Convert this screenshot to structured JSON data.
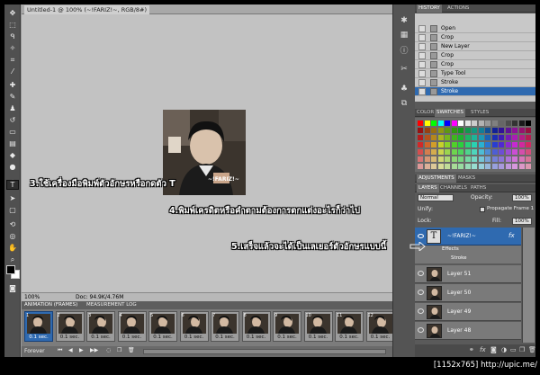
{
  "document": {
    "tab_title": "Untitled-1 @ 100% (~!FARIZ!~, RGB/8#)",
    "zoom": "100%",
    "doc_size": "Doc: 94.9K/4.76M",
    "canvas_watermark": "~!FARIZ!~"
  },
  "history_panel": {
    "tabs": [
      "HISTORY",
      "ACTIONS"
    ],
    "steps": [
      "Open",
      "Crop",
      "New Layer",
      "Crop",
      "Crop",
      "Type Tool",
      "Stroke",
      "Stroke"
    ],
    "selected_index": 7
  },
  "swatches_panel": {
    "tabs": [
      "COLOR",
      "SWATCHES",
      "STYLES"
    ]
  },
  "adjustments_panel": {
    "tabs": [
      "ADJUSTMENTS",
      "MASKS"
    ]
  },
  "layers_panel": {
    "tabs": [
      "LAYERS",
      "CHANNELS",
      "PATHS"
    ],
    "blend_mode": "Normal",
    "opacity_label": "Opacity:",
    "opacity_value": "100%",
    "unify_label": "Unify:",
    "propagate_label": "Propagate Frame 1",
    "lock_label": "Lock:",
    "fill_label": "Fill:",
    "fill_value": "100%",
    "text_layer": "~!FARIZ!~",
    "effects_label": "Effects",
    "stroke_label": "Stroke",
    "layers": [
      "Layer 51",
      "Layer 50",
      "Layer 49",
      "Layer 48"
    ]
  },
  "animation_panel": {
    "tabs": [
      "ANIMATION (FRAMES)",
      "MEASUREMENT LOG"
    ],
    "frame_numbers": [
      "1",
      "2",
      "3",
      "4",
      "5",
      "6",
      "7",
      "8",
      "9",
      "10",
      "11",
      "12"
    ],
    "frame_delay": "0.1 sec.",
    "loop": "Forever"
  },
  "annotations": {
    "step3": "3.ใช้เครื่องมือพิมพ์ตัวอักษรหรือกดตัว T",
    "step4": "4.พิมพ์เครดิตหรือคำตามต้องการตกแต่งอะไรก็ว่าไป",
    "step5": "5.เสร็จแล้วจะได้เป็นเลเยอร์ตัวอักษรแบบนี้"
  },
  "footer": "[1152x765] http://upic.me/",
  "colors": {
    "selection_blue": "#2f6ab0",
    "panel_dark": "#5a5a5a",
    "canvas_bg": "#c2c2c2"
  }
}
